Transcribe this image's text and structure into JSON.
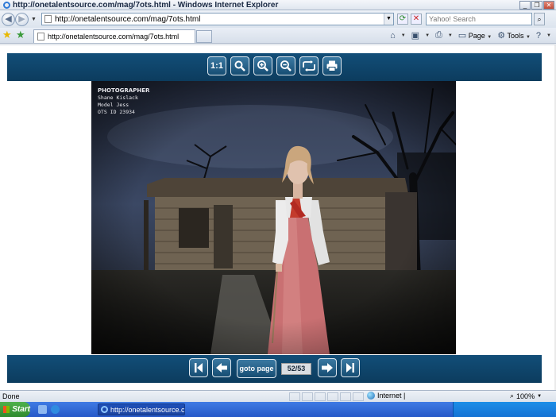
{
  "window": {
    "title": "http://onetalentsource.com/mag/7ots.html - Windows Internet Explorer",
    "controls": [
      "minimize",
      "restore",
      "close"
    ]
  },
  "navbar": {
    "back_icon": "back-arrow-icon",
    "forward_icon": "forward-arrow-icon",
    "address": "http://onetalentsource.com/mag/7ots.html",
    "search_placeholder": "Yahoo! Search"
  },
  "tabs": [
    {
      "label": "http://onetalentsource.com/mag/7ots.html"
    }
  ],
  "commandbar": {
    "page_label": "Page",
    "tools_label": "Tools"
  },
  "viewer": {
    "top_toolbar": [
      {
        "name": "actual-size-button",
        "label": "1:1"
      },
      {
        "name": "zoom-button",
        "icon": "magnifier-icon"
      },
      {
        "name": "zoom-in-button",
        "icon": "zoom-in-icon"
      },
      {
        "name": "zoom-out-button",
        "icon": "zoom-out-icon"
      },
      {
        "name": "flip-button",
        "icon": "flip-icon"
      },
      {
        "name": "print-button",
        "icon": "printer-icon"
      }
    ],
    "caption": {
      "heading": "PHOTOGRAPHER",
      "lines": [
        "Shane Kislack",
        "Model Jess",
        "OTS ID 23934"
      ]
    },
    "bottom_toolbar": {
      "goto_label": "goto page",
      "page_indicator": "52/53"
    },
    "colors": {
      "toolbar": "#0c3c5e",
      "button": "#1f5f89"
    }
  },
  "statusbar": {
    "status": "Done",
    "zone": "Internet |",
    "zoom": "100%"
  },
  "taskbar": {
    "start_label": "Start",
    "task_item": "http://onetalentsource.c..."
  }
}
